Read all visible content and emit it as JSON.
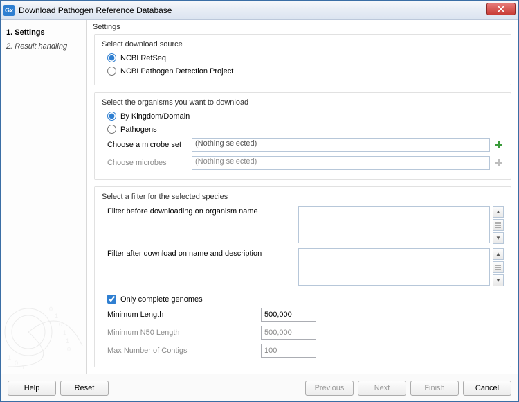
{
  "window": {
    "appIconText": "Gx",
    "title": "Download Pathogen Reference Database"
  },
  "sidebar": {
    "steps": [
      {
        "num": "1.",
        "label": "Settings"
      },
      {
        "num": "2.",
        "label": "Result handling"
      }
    ]
  },
  "main": {
    "heading": "Settings",
    "section1": {
      "legend": "Select download source",
      "opt1": "NCBI RefSeq",
      "opt2": "NCBI Pathogen Detection Project"
    },
    "section2": {
      "legend": "Select the organisms you want to download",
      "opt1": "By Kingdom/Domain",
      "opt2": "Pathogens",
      "setLabel": "Choose a microbe set",
      "setValue": "(Nothing selected)",
      "microbesLabel": "Choose microbes",
      "microbesValue": "(Nothing selected)"
    },
    "section3": {
      "legend": "Select a filter for the selected species",
      "filter1": "Filter before downloading on organism name",
      "filter2": "Filter after download on name and description",
      "completeLabel": "Only complete genomes",
      "minLenLabel": "Minimum Length",
      "minLenValue": "500,000",
      "n50Label": "Minimum N50 Length",
      "n50Value": "500,000",
      "maxContigsLabel": "Max Number of Contigs",
      "maxContigsValue": "100"
    }
  },
  "footer": {
    "help": "Help",
    "reset": "Reset",
    "previous": "Previous",
    "next": "Next",
    "finish": "Finish",
    "cancel": "Cancel"
  }
}
